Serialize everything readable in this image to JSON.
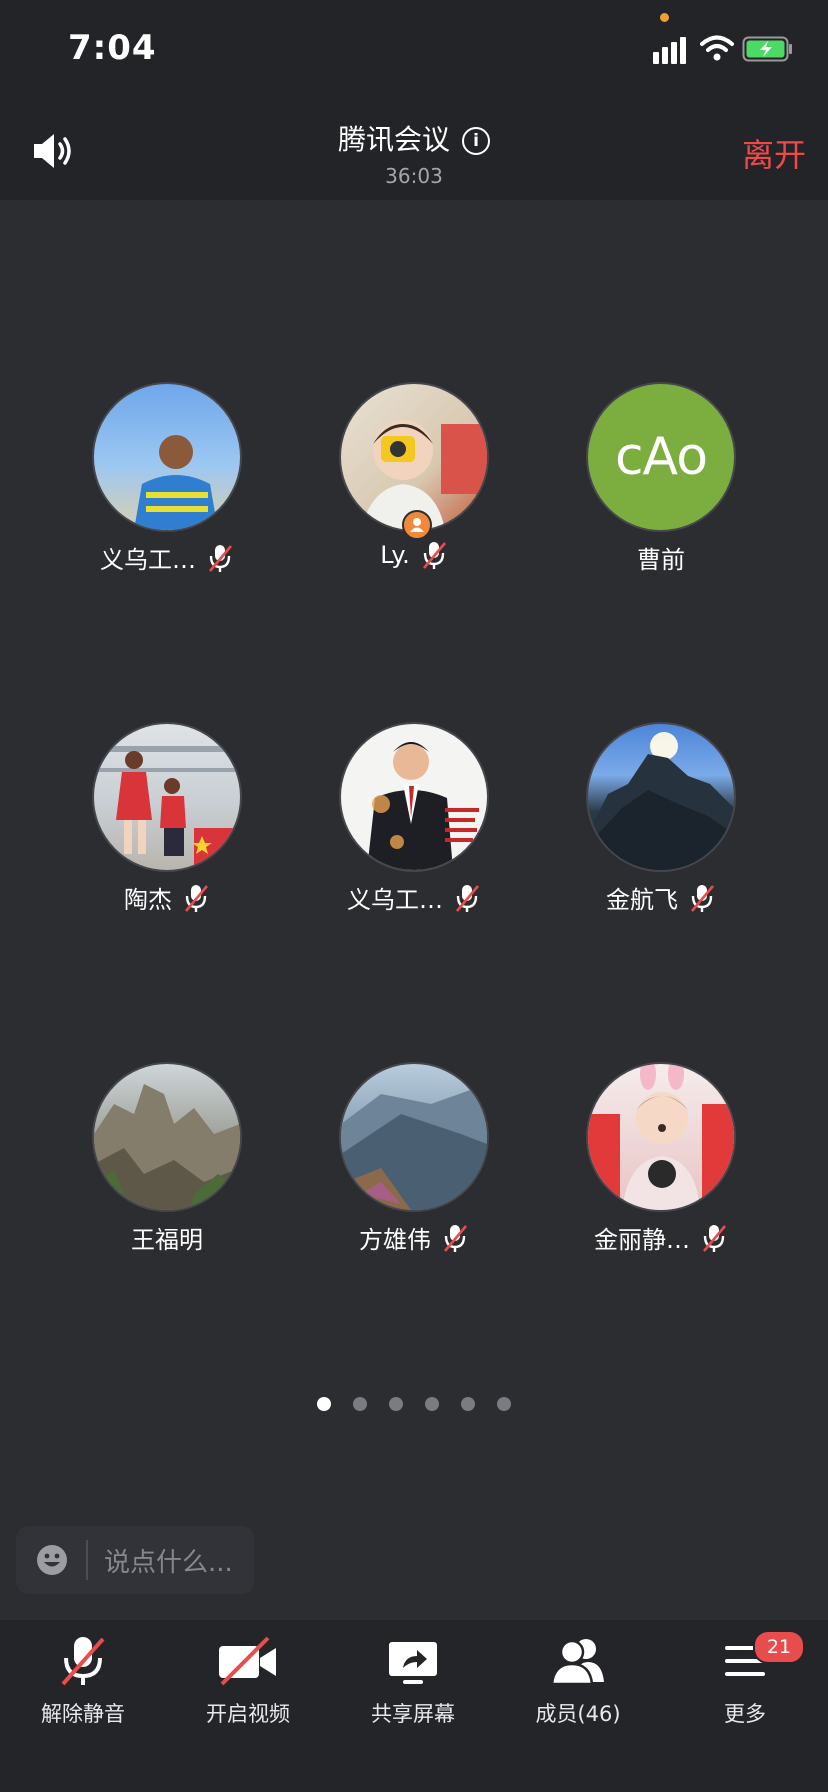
{
  "status_bar": {
    "time": "7:04",
    "icons": [
      "signal-icon",
      "wifi-icon",
      "battery-charging-icon"
    ]
  },
  "header": {
    "title": "腾讯会议",
    "timer": "36:03",
    "leave_label": "离开",
    "speaker_icon": "speaker-icon",
    "info_icon": "info-icon"
  },
  "participants": [
    {
      "name": "义乌工…",
      "muted": true
    },
    {
      "name": "Ly.",
      "muted": true,
      "host": true
    },
    {
      "name": "曹前",
      "muted": false,
      "avatar_text": "cAo"
    },
    {
      "name": "陶杰",
      "muted": true
    },
    {
      "name": "义乌工…",
      "muted": true
    },
    {
      "name": "金航飞",
      "muted": true
    },
    {
      "name": "王福明",
      "muted": false
    },
    {
      "name": "方雄伟",
      "muted": true
    },
    {
      "name": "金丽静…",
      "muted": true
    }
  ],
  "pagination": {
    "pages": 6,
    "current": 1
  },
  "chat": {
    "placeholder": "说点什么..."
  },
  "toolbar": {
    "unmute_label": "解除静音",
    "video_label": "开启视频",
    "share_label": "共享屏幕",
    "members_label": "成员(46)",
    "more_label": "更多",
    "more_badge": "21"
  },
  "colors": {
    "accent_red": "#ee4a4a",
    "background": "#2c2d31",
    "bar": "#232428",
    "avatar_green": "#7cae3f"
  }
}
